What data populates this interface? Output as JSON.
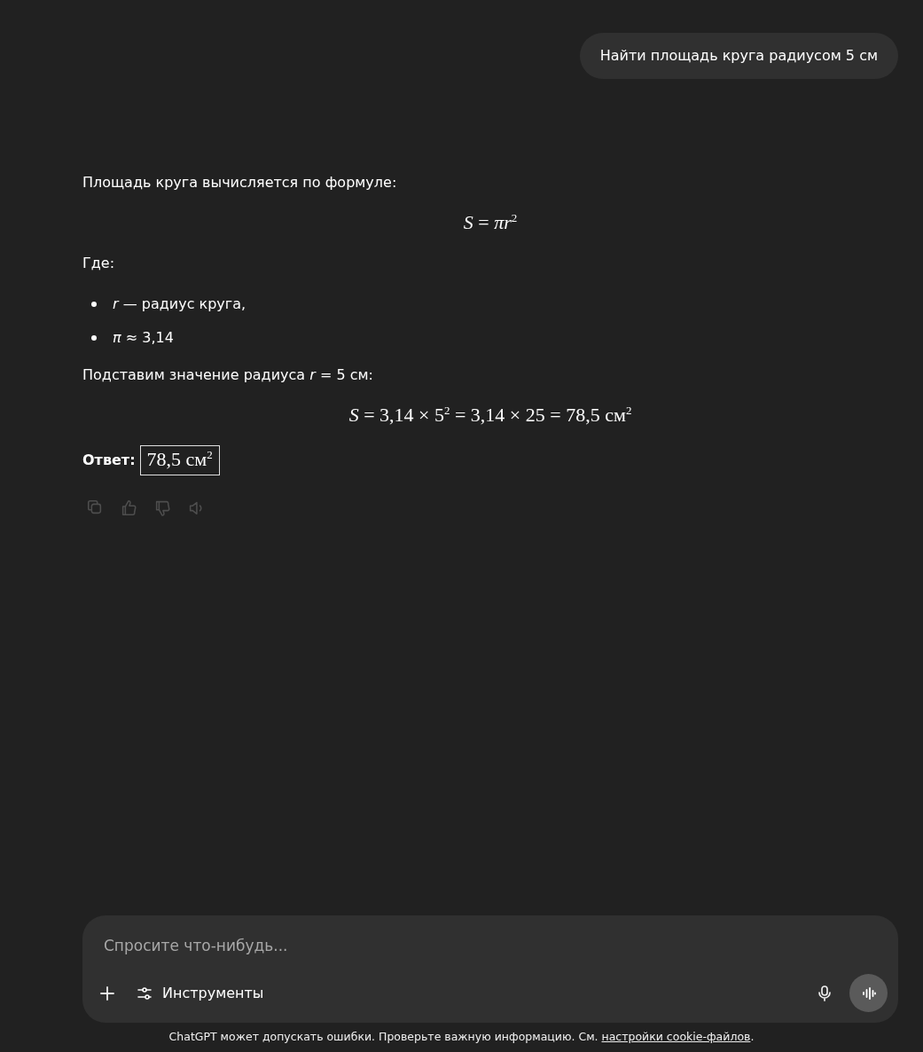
{
  "user_message": "Найти площадь круга радиусом 5 см",
  "response": [
    {
      "kind": "paragraph",
      "text": "Площадь круга вычисляется по формуле:"
    },
    {
      "kind": "formula",
      "text": "*S* = *πr*$^{2}$"
    },
    {
      "kind": "paragraph",
      "text": "Где:"
    },
    {
      "kind": "list",
      "items": [
        "*r* — радиус круга,",
        "*π* ≈ 3,14"
      ]
    },
    {
      "kind": "paragraph",
      "text": "Подставим значение радиуса *r* = 5 см:"
    },
    {
      "kind": "formula",
      "text": "*S* = 3,14 × 5$^{2}$ = 3,14 × 25 = 78,5 см$^{2}$"
    },
    {
      "kind": "answer",
      "label": "Ответ:",
      "value": "78,5 см$^{2}$"
    }
  ],
  "actions": [
    {
      "kind": "copy"
    },
    {
      "kind": "like"
    },
    {
      "kind": "dislike"
    },
    {
      "kind": "speak"
    }
  ],
  "composer": {
    "placeholder": "Спросите что-нибудь...",
    "tools_label": "Инструменты"
  },
  "disclaimer": {
    "text": "ChatGPT может допускать ошибки. Проверьте важную информацию. См. ",
    "link": "настройки cookie-файлов",
    "end": "."
  }
}
